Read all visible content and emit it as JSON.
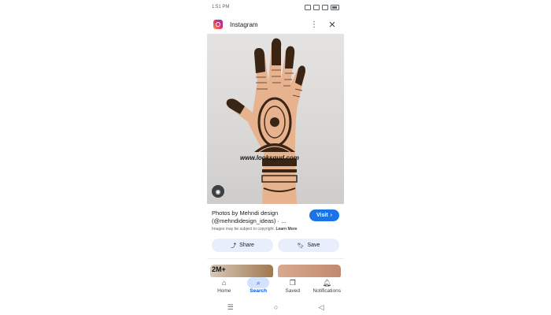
{
  "status": {
    "time": "1:51 PM"
  },
  "app": {
    "title": "Instagram"
  },
  "image": {
    "watermark": "www.looksgud.com"
  },
  "result": {
    "title": "Photos by Mehndi design (@mehndidesign_ideas) · ...",
    "visit_label": "Visit",
    "copyright_text": "Images may be subject to copyright.",
    "learn_more": "Learn More"
  },
  "actions": {
    "share_label": "Share",
    "save_label": "Save"
  },
  "thumbs": {
    "first_label": "2M+"
  },
  "nav": {
    "home": "Home",
    "search": "Search",
    "saved": "Saved",
    "notifications": "Notifications"
  },
  "colors": {
    "accent": "#1a73e8",
    "active_pill": "#d3e3fd",
    "button_bg": "#e8eefb"
  }
}
